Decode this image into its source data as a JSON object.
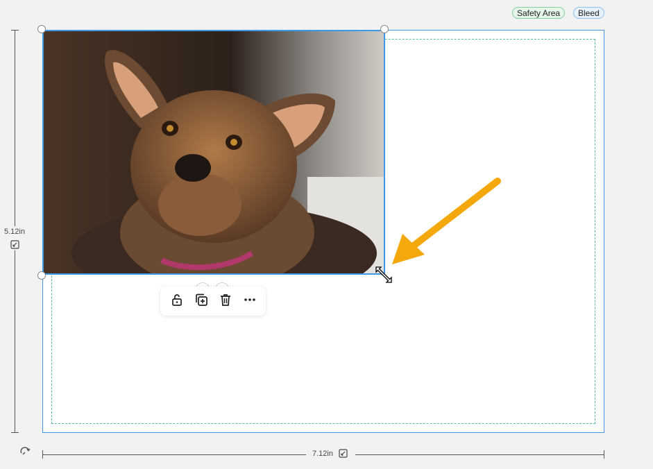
{
  "legend": {
    "safety_area": "Safety Area",
    "bleed": "Bleed"
  },
  "dimensions": {
    "height": "5.12in",
    "width": "7.12in"
  },
  "toolbar": {
    "unlock_icon": "unlock-icon",
    "duplicate_icon": "duplicate-icon",
    "delete_icon": "trash-icon",
    "more_icon": "more-options-icon"
  },
  "colors": {
    "selection": "#3d99e6",
    "safety_dash": "#5bbf94",
    "arrow": "#f4a80b"
  }
}
